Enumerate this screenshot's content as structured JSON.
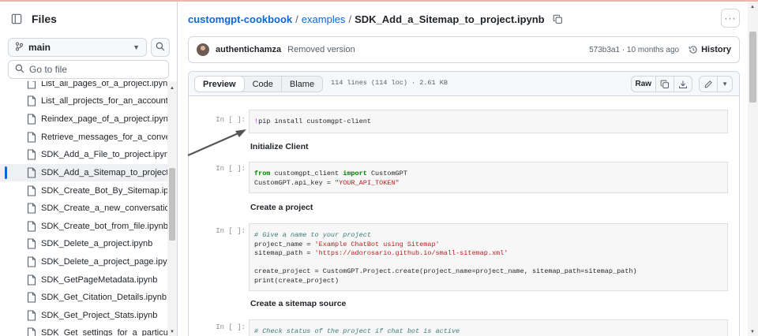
{
  "sidebar": {
    "title": "Files",
    "branch": "main",
    "goto_placeholder": "Go to file",
    "files": [
      {
        "label": "List_all_pages_of_a_project.ipynb",
        "active": false
      },
      {
        "label": "List_all_projects_for_an_account...",
        "active": false
      },
      {
        "label": "Reindex_page_of_a_project.ipynb",
        "active": false
      },
      {
        "label": "Retrieve_messages_for_a_conve...",
        "active": false
      },
      {
        "label": "SDK_Add_a_File_to_project.ipynb",
        "active": false
      },
      {
        "label": "SDK_Add_a_Sitemap_to_project...",
        "active": true
      },
      {
        "label": "SDK_Create_Bot_By_Sitemap.ipy...",
        "active": false
      },
      {
        "label": "SDK_Create_a_new_conversatio...",
        "active": false
      },
      {
        "label": "SDK_Create_bot_from_file.ipynb",
        "active": false
      },
      {
        "label": "SDK_Delete_a_project.ipynb",
        "active": false
      },
      {
        "label": "SDK_Delete_a_project_page.ipy...",
        "active": false
      },
      {
        "label": "SDK_GetPageMetadata.ipynb",
        "active": false
      },
      {
        "label": "SDK_Get_Citation_Details.ipynb",
        "active": false
      },
      {
        "label": "SDK_Get_Project_Stats.ipynb",
        "active": false
      },
      {
        "label": "SDK_Get_settings_for_a_particul...",
        "active": false
      }
    ]
  },
  "breadcrumb": {
    "repo": "customgpt-cookbook",
    "folder": "examples",
    "file": "SDK_Add_a_Sitemap_to_project.ipynb",
    "sep1": "/",
    "sep2": "/"
  },
  "commit": {
    "author": "authentichamza",
    "message": "Removed version",
    "meta": "573b3a1 · 10 months ago",
    "history_label": "History"
  },
  "file_header": {
    "tabs": [
      "Preview",
      "Code",
      "Blame"
    ],
    "active_tab": "Preview",
    "line_info": "114 lines (114 loc) · 2.61 KB",
    "raw_label": "Raw"
  },
  "notebook": {
    "prompts": [
      "In [ ]:",
      "In [ ]:",
      "In [ ]:",
      "In [ ]:"
    ],
    "cell1": {
      "bang": "!",
      "rest": "pip install customgpt-client"
    },
    "md1": "Initialize Client",
    "cell2": {
      "l1_kw1": "from",
      "l1_mid": " customgpt_client ",
      "l1_kw2": "import",
      "l1_end": " CustomGPT",
      "l2_a": "CustomGPT.api_key = ",
      "l2_str": "\"YOUR_API_TOKEN\""
    },
    "md2": "Create a project",
    "cell3": {
      "c1": "# Give a name to your project",
      "l2_a": "project_name = ",
      "l2_str": "'Example ChatBot using Sitemap'",
      "l3_a": "sitemap_path = ",
      "l3_str": "'https://adorosario.github.io/small-sitemap.xml'",
      "l5": "create_project = CustomGPT.Project.create(project_name=project_name, sitemap_path=sitemap_path)",
      "l6": "print(create_project)"
    },
    "md3": "Create a sitemap source",
    "cell4": {
      "c1": "# Check status of the project if chat bot is active"
    }
  },
  "colors": {
    "link": "#0969da",
    "active_marker": "#0969da",
    "border": "#d0d7de"
  }
}
